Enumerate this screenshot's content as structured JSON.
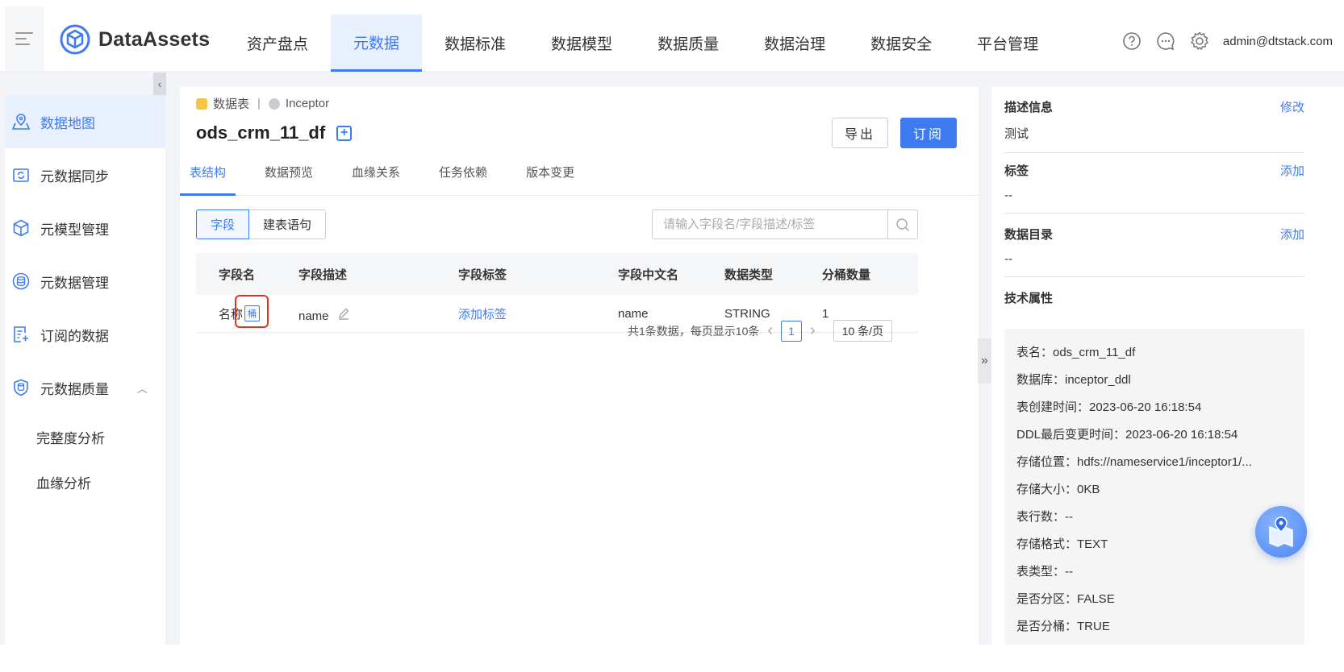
{
  "header": {
    "logo_text": "DataAssets",
    "nav": [
      "资产盘点",
      "元数据",
      "数据标准",
      "数据模型",
      "数据质量",
      "数据治理",
      "数据安全",
      "平台管理"
    ],
    "active_nav": "元数据",
    "user": "admin@dtstack.com"
  },
  "sidebar": {
    "items": [
      {
        "label": "数据地图",
        "icon": "map-icon"
      },
      {
        "label": "元数据同步",
        "icon": "sync-icon"
      },
      {
        "label": "元模型管理",
        "icon": "cube-icon"
      },
      {
        "label": "元数据管理",
        "icon": "database-icon"
      },
      {
        "label": "订阅的数据",
        "icon": "subscribe-icon"
      },
      {
        "label": "元数据质量",
        "icon": "quality-icon"
      }
    ],
    "sub_items": [
      "完整度分析",
      "血缘分析"
    ]
  },
  "main": {
    "breadcrumb": {
      "type": "数据表",
      "source": "Inceptor"
    },
    "title": "ods_crm_11_df",
    "export_label": "导出",
    "subscribe_label": "订阅",
    "tabs": [
      "表结构",
      "数据预览",
      "血缘关系",
      "任务依赖",
      "版本变更"
    ],
    "toggle": [
      "字段",
      "建表语句"
    ],
    "search_placeholder": "请输入字段名/字段描述/标签",
    "columns": [
      "字段名",
      "字段描述",
      "字段标签",
      "字段中文名",
      "数据类型",
      "分桶数量"
    ],
    "row": {
      "name": "名称",
      "bucket_tag": "桶",
      "desc": "name",
      "tag_action": "添加标签",
      "cn_name": "name",
      "type": "STRING",
      "buckets": "1"
    },
    "pager": {
      "summary": "共1条数据，每页显示10条",
      "page": "1",
      "size": "10 条/页"
    }
  },
  "right": {
    "desc": {
      "title": "描述信息",
      "action": "修改",
      "value": "测试"
    },
    "tags": {
      "title": "标签",
      "action": "添加",
      "value": "--"
    },
    "catalog": {
      "title": "数据目录",
      "action": "添加",
      "value": "--"
    },
    "tech": {
      "title": "技术属性",
      "lines": [
        "表名：ods_crm_11_df",
        "数据库：inceptor_ddl",
        "表创建时间：2023-06-20 16:18:54",
        "DDL最后变更时间：2023-06-20 16:18:54",
        "存储位置：hdfs://nameservice1/inceptor1/...",
        "存储大小：0KB",
        "表行数：--",
        "存储格式：TEXT",
        "表类型：--",
        "是否分区：FALSE",
        "是否分桶：TRUE"
      ]
    }
  },
  "colors": {
    "accent": "#3f7bf0",
    "highlight": "#e0321f"
  }
}
